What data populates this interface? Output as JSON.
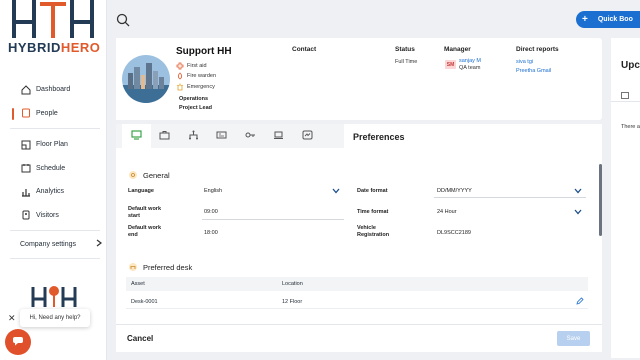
{
  "brand": {
    "word1": "HYBRID",
    "word2": "HERO"
  },
  "sidebar": {
    "items": [
      {
        "label": "Dashboard",
        "icon": "home-icon"
      },
      {
        "label": "People",
        "icon": "people-icon",
        "active": true
      },
      {
        "label": "Floor Plan",
        "icon": "floor-plan-icon"
      },
      {
        "label": "Schedule",
        "icon": "schedule-icon"
      },
      {
        "label": "Analytics",
        "icon": "analytics-icon"
      },
      {
        "label": "Visitors",
        "icon": "visitors-icon"
      }
    ],
    "company_settings": "Company settings"
  },
  "chat": {
    "bubble": "Hi, Need any help?"
  },
  "topbar": {
    "quick_button": "Quick Boo"
  },
  "profile": {
    "name": "Support HH",
    "roles": [
      "First aid",
      "Fire warden",
      "Emergency"
    ],
    "teams": [
      "Operations",
      "Project Lead"
    ],
    "contact_header": "Contact",
    "status_header": "Status",
    "status_value": "Full Time",
    "manager_header": "Manager",
    "manager_initials": "SM",
    "manager_name": "sanjay M",
    "manager_team": "QA team",
    "reports_header": "Direct reports",
    "reports": [
      "siva tgi",
      "Preetha Gmail"
    ]
  },
  "right_panel": {
    "title": "Upc",
    "text": "There a"
  },
  "preferences": {
    "title": "Preferences",
    "general": {
      "title": "General",
      "language_label": "Language",
      "language_value": "English",
      "start_label_1": "Default work",
      "start_label_2": "start",
      "start_value": "09:00",
      "end_label_1": "Default work",
      "end_label_2": "end",
      "end_value": "18:00",
      "date_format_label": "Date format",
      "date_format_value": "DD/MM/YYYY",
      "time_format_label": "Time format",
      "time_format_value": "24 Hour",
      "vehicle_label_1": "Vehicle",
      "vehicle_label_2": "Registration",
      "vehicle_value": "DL9SCC2189"
    },
    "preferred_desk": {
      "title": "Preferred desk",
      "columns": [
        "Asset",
        "Location"
      ],
      "rows": [
        {
          "asset": "Desk-0001",
          "location": "12 Floor"
        }
      ]
    }
  },
  "footer": {
    "cancel": "Cancel",
    "save": "Save"
  },
  "colors": {
    "accent": "#1b6fd1",
    "brand_orange": "#e05a2b",
    "brand_navy": "#243b55"
  }
}
